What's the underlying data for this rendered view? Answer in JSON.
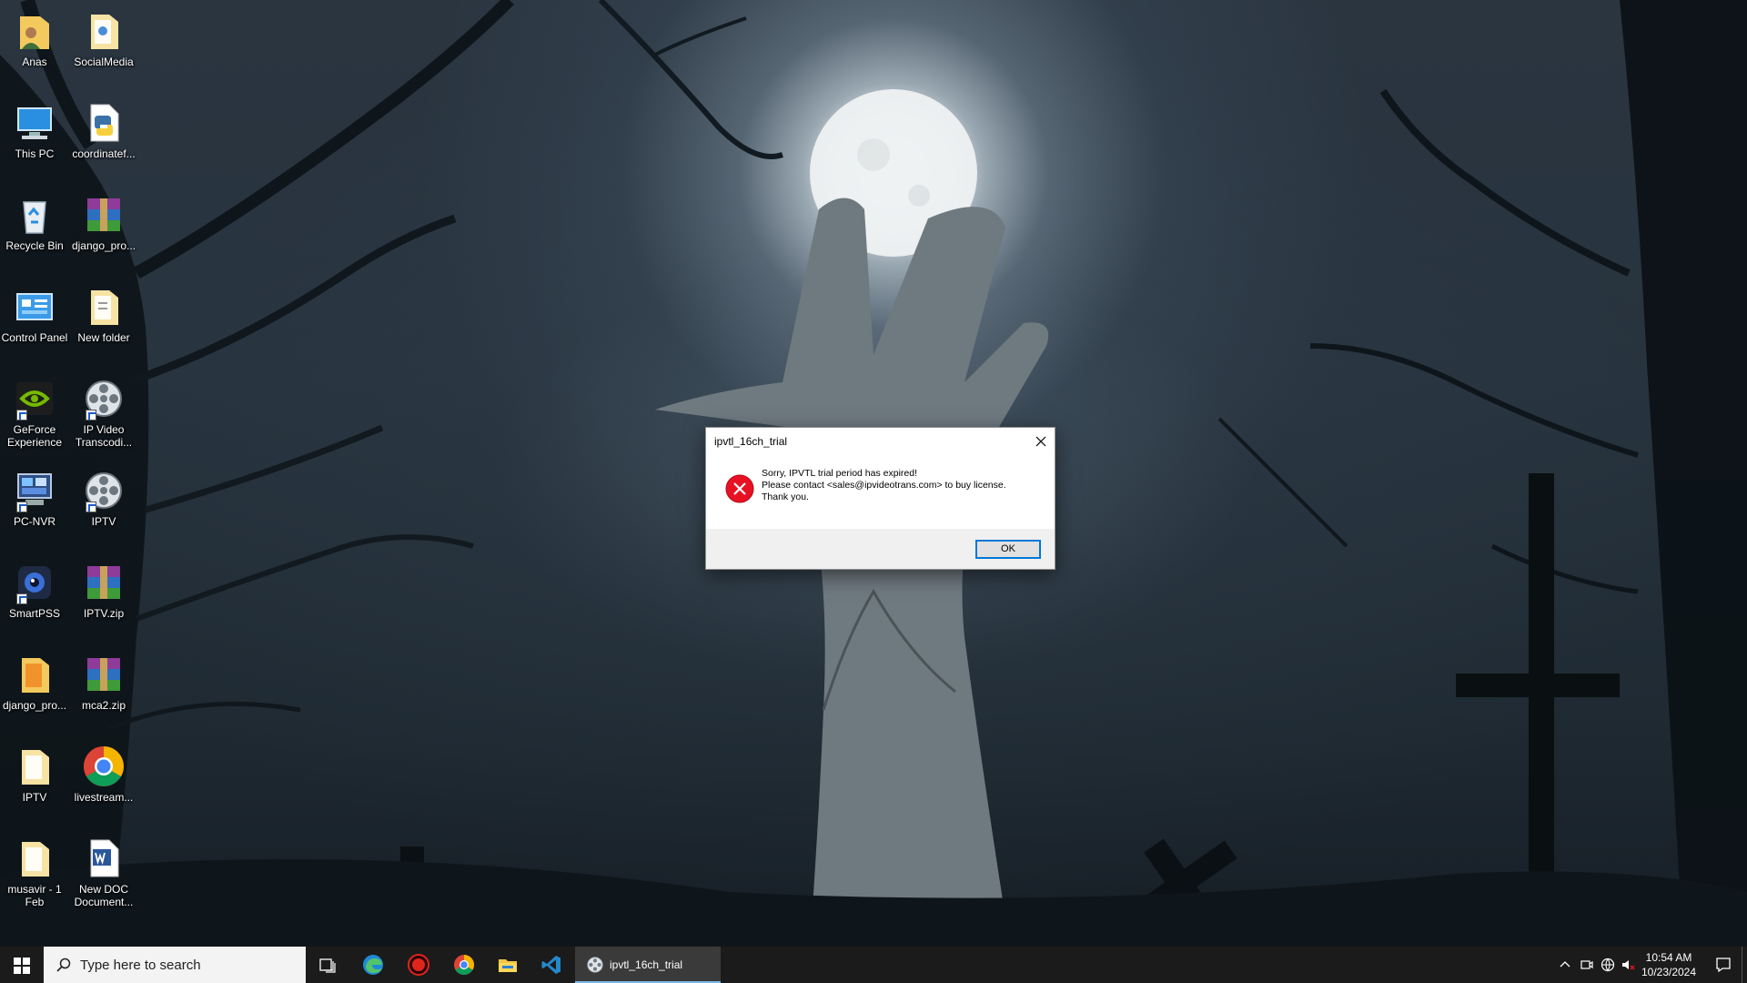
{
  "desktop": {
    "icons": [
      {
        "label": "Anas",
        "icon": "user-folder-icon"
      },
      {
        "label": "SocialMedia",
        "icon": "folder-icon"
      },
      {
        "label": "This PC",
        "icon": "this-pc-icon"
      },
      {
        "label": "coordinatef...",
        "icon": "python-file-icon"
      },
      {
        "label": "Recycle Bin",
        "icon": "recycle-bin-icon"
      },
      {
        "label": "django_pro...",
        "icon": "winrar-archive-icon"
      },
      {
        "label": "Control Panel",
        "icon": "control-panel-icon"
      },
      {
        "label": "New folder",
        "icon": "folder-icon"
      },
      {
        "label": "GeForce Experience",
        "icon": "nvidia-icon"
      },
      {
        "label": "IP Video Transcodi...",
        "icon": "film-reel-icon"
      },
      {
        "label": "PC-NVR",
        "icon": "pc-nvr-icon"
      },
      {
        "label": "IPTV",
        "icon": "film-reel-icon"
      },
      {
        "label": "SmartPSS",
        "icon": "smartpss-icon"
      },
      {
        "label": "IPTV.zip",
        "icon": "winrar-archive-icon"
      },
      {
        "label": "django_pro...",
        "icon": "folder-icon"
      },
      {
        "label": "mca2.zip",
        "icon": "winrar-archive-icon"
      },
      {
        "label": "IPTV",
        "icon": "folder-icon"
      },
      {
        "label": "livestream...",
        "icon": "chrome-icon"
      },
      {
        "label": "musavir - 1 Feb",
        "icon": "folder-icon"
      },
      {
        "label": "New DOC Document...",
        "icon": "word-document-icon"
      }
    ]
  },
  "dialog": {
    "title": "ipvtl_16ch_trial",
    "icon": "error-icon",
    "message_line1": "Sorry, IPVTL trial period has expired!",
    "message_line2": "Please contact <sales@ipvideotrans.com> to buy license.",
    "message_line3": "Thank you.",
    "ok_label": "OK"
  },
  "taskbar": {
    "search_placeholder": "Type here to search",
    "pinned": [
      "task-view-icon",
      "edge-icon",
      "record-icon",
      "chrome-icon",
      "file-explorer-icon",
      "vscode-icon"
    ],
    "active_app_label": "ipvtl_16ch_trial",
    "clock_time": "10:54 AM",
    "clock_date": "10/23/2024"
  },
  "colors": {
    "taskbar_bg": "#1b1b1b",
    "accent": "#0078d7",
    "error_red": "#e81123"
  }
}
